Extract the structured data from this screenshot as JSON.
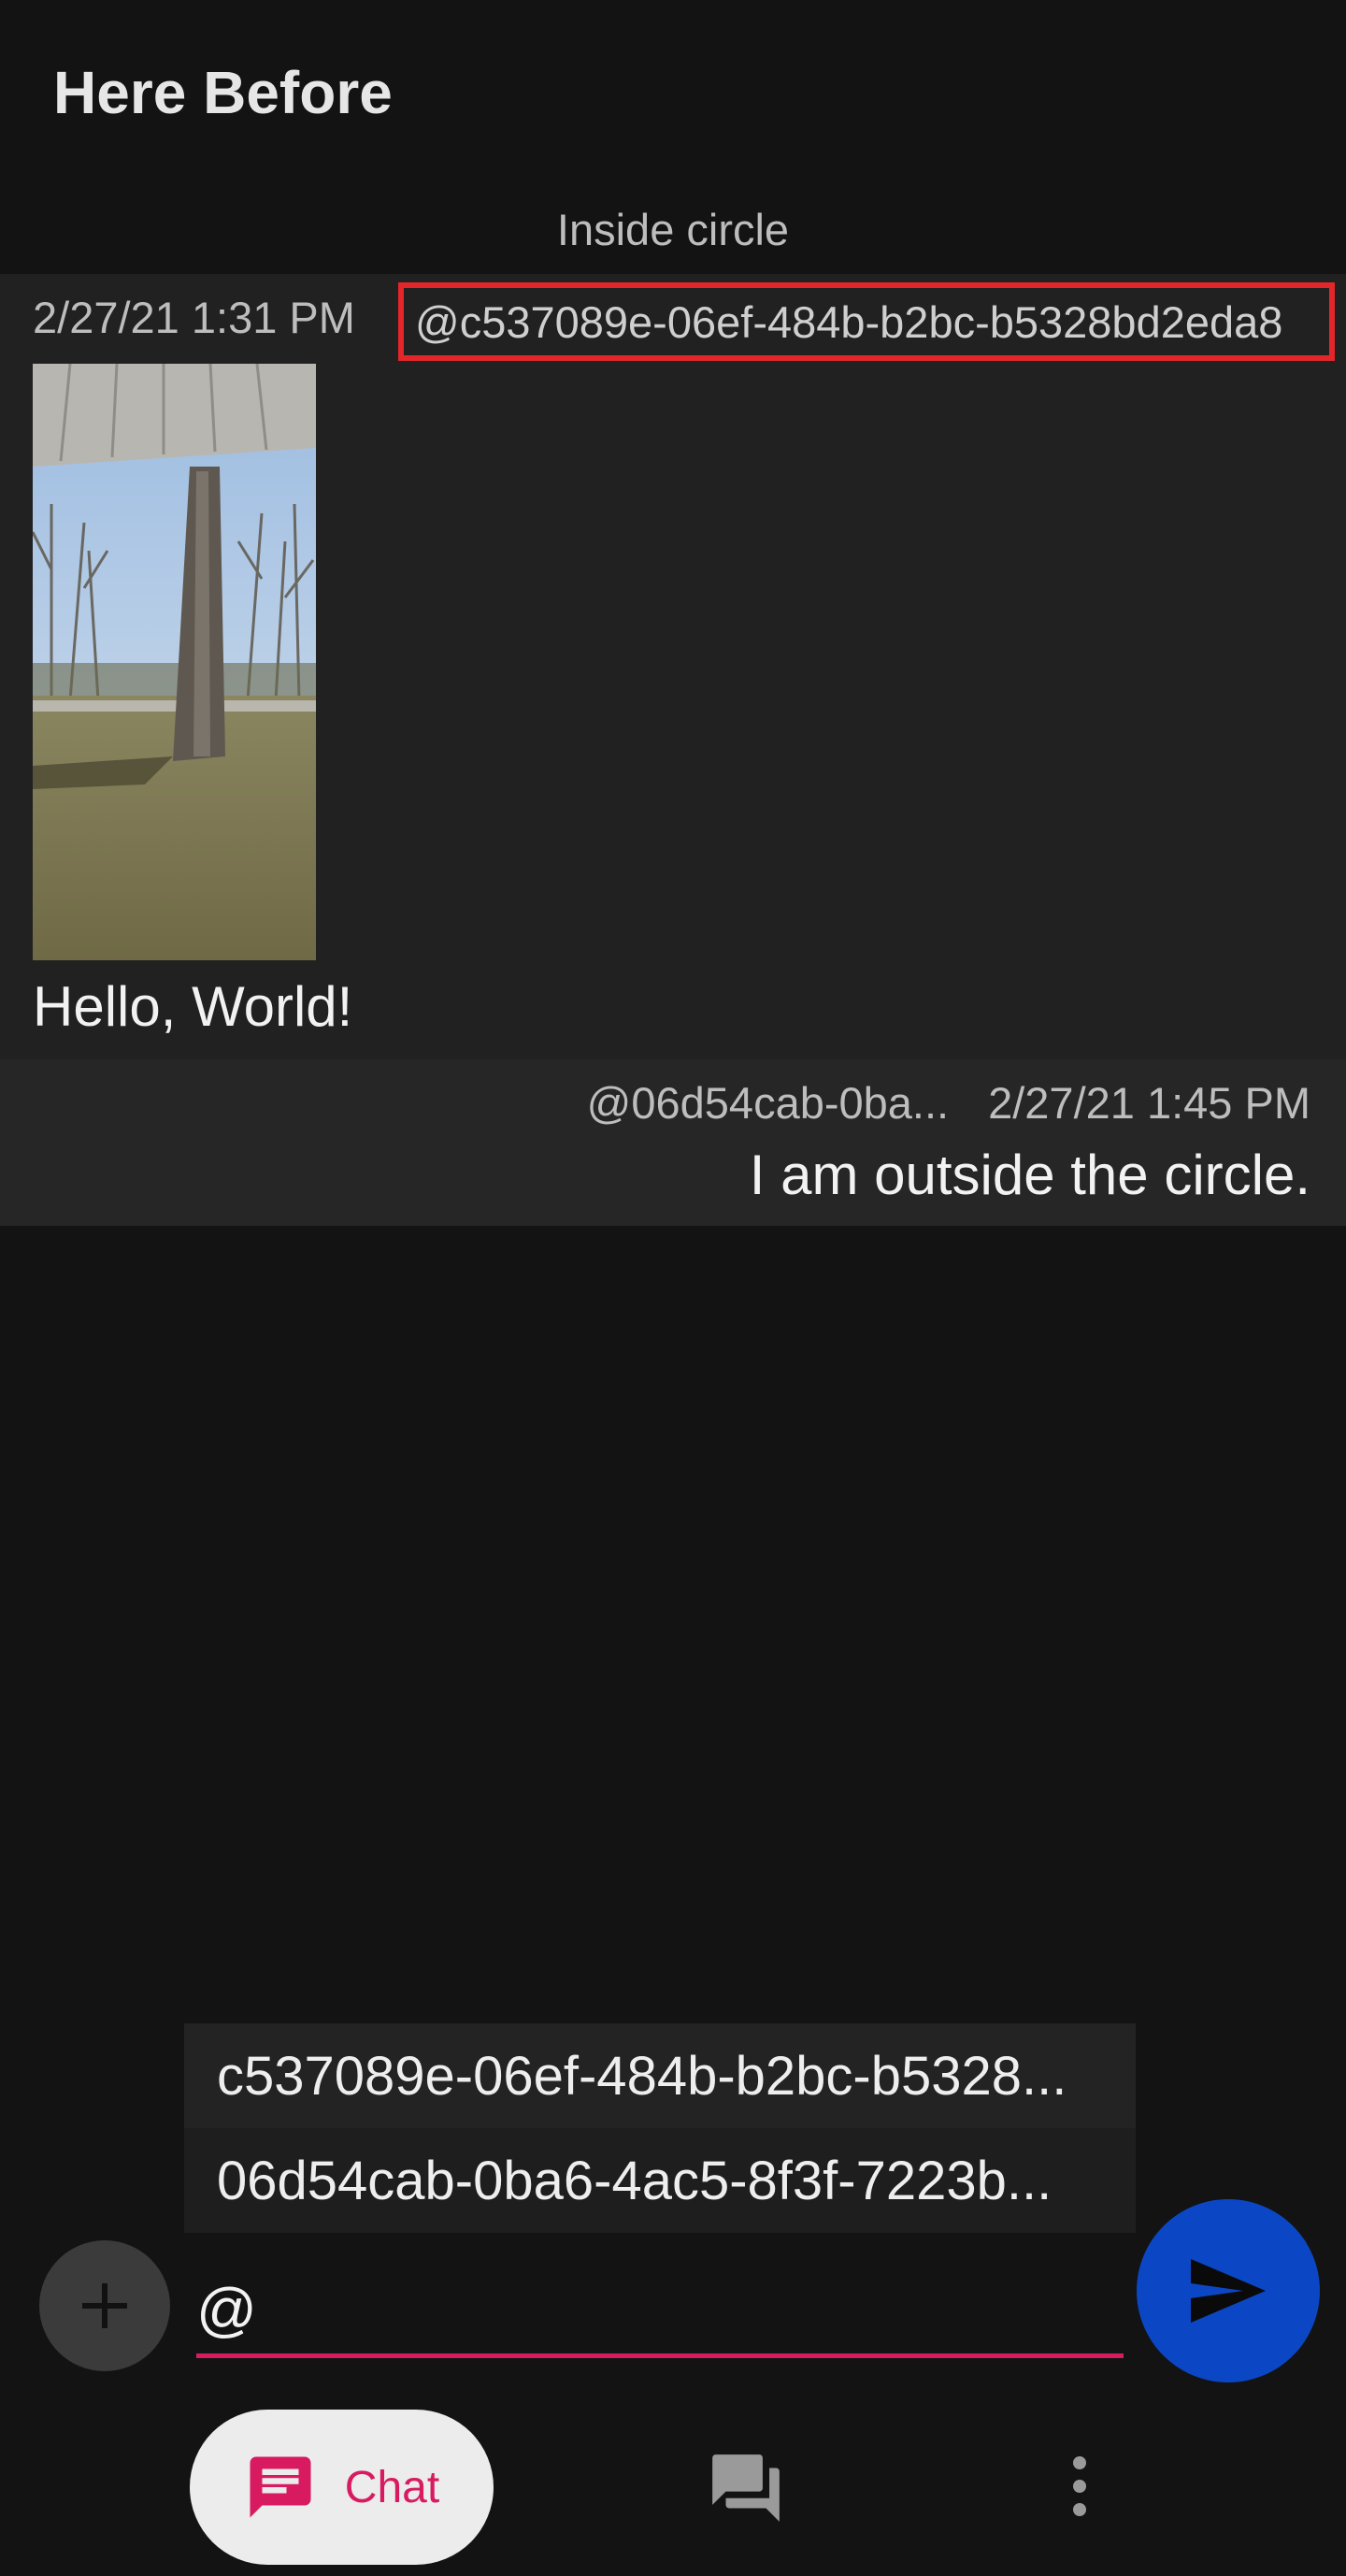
{
  "app": {
    "title": "Here Before"
  },
  "section": {
    "label": "Inside circle"
  },
  "messages": [
    {
      "timestamp": "2/27/21 1:31 PM",
      "author": "@c537089e-06ef-484b-b2bc-b5328bd2eda8",
      "image": "tree-photo",
      "text": "Hello, World!"
    },
    {
      "author": "@06d54cab-0ba...",
      "timestamp": "2/27/21 1:45 PM",
      "text": "I am outside the circle."
    }
  ],
  "mention_suggestions": [
    "c537089e-06ef-484b-b2bc-b5328...",
    "06d54cab-0ba6-4ac5-8f3f-7223b..."
  ],
  "composer": {
    "value": "@",
    "add_icon": "plus-icon",
    "send_icon": "send-icon"
  },
  "bottom_nav": {
    "items": [
      {
        "label": "Chat",
        "icon": "chat-icon",
        "selected": true
      },
      {
        "label": "",
        "icon": "forum-icon"
      },
      {
        "label": "",
        "icon": "more-vert-icon"
      }
    ]
  },
  "colors": {
    "background": "#131314",
    "message_bg": "#212122",
    "highlight_border": "#e3262a",
    "accent": "#d81b60",
    "send_button": "#0b47c4"
  }
}
